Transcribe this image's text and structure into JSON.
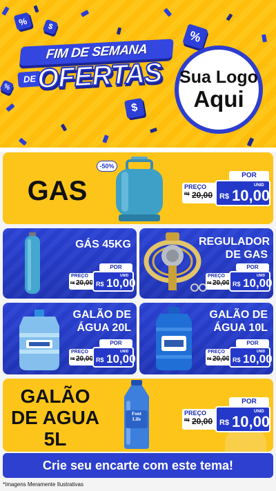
{
  "header": {
    "title_line1": "FIM DE SEMANA",
    "title_de": "DE",
    "title_line2": "OFERTAS",
    "logo_line1": "Sua Logo",
    "logo_line2": "Aqui",
    "cube_labels": [
      "%",
      "$",
      "%",
      "$",
      "%"
    ]
  },
  "products": {
    "gas": {
      "name": "GAS",
      "discount_badge": "-50%",
      "por": "POR",
      "preco": "PREÇO",
      "old_prefix": "R$",
      "old_price": "20,00",
      "unid": "UNID",
      "currency": "R$",
      "price": "10,00"
    },
    "gas45": {
      "name": "GÁS 45KG",
      "por": "POR",
      "preco": "PREÇO",
      "old_prefix": "R$",
      "old_price": "20,00",
      "unid": "UNID",
      "currency": "R$",
      "price": "10,00"
    },
    "regulador": {
      "name_line1": "REGULADOR",
      "name_line2": "DE GAS",
      "por": "POR",
      "preco": "PREÇO",
      "old_prefix": "R$",
      "old_price": "20,00",
      "unid": "UNID",
      "currency": "R$",
      "price": "10,00"
    },
    "galao20": {
      "name_line1": "GALÃO DE",
      "name_line2": "ÁGUA 20L",
      "por": "POR",
      "preco": "PREÇO",
      "old_prefix": "R$",
      "old_price": "20,00",
      "unid": "UNID",
      "currency": "R$",
      "price": "10,00"
    },
    "galao10": {
      "name_line1": "GALÃO DE",
      "name_line2": "ÁGUA 10L",
      "por": "POR",
      "preco": "PREÇO",
      "old_prefix": "R$",
      "old_price": "20,00",
      "unid": "UNID",
      "currency": "R$",
      "price": "10,00"
    },
    "galao5": {
      "name_line1": "GALÃO",
      "name_line2": "DE AGUA",
      "name_line3": "5L",
      "bottle_brand_line1": "Font",
      "bottle_brand_line2": "Life",
      "por": "POR",
      "preco": "PREÇO",
      "old_prefix": "R$",
      "old_price": "20,00",
      "unid": "UNID",
      "currency": "R$",
      "price": "10,00"
    }
  },
  "footer": {
    "cta": "Crie seu encarte com este tema!",
    "disclaimer": "*Imagens Meramente Ilustrativas"
  },
  "colors": {
    "yellow": "#fdc51a",
    "blue": "#2438c9",
    "white": "#ffffff"
  }
}
